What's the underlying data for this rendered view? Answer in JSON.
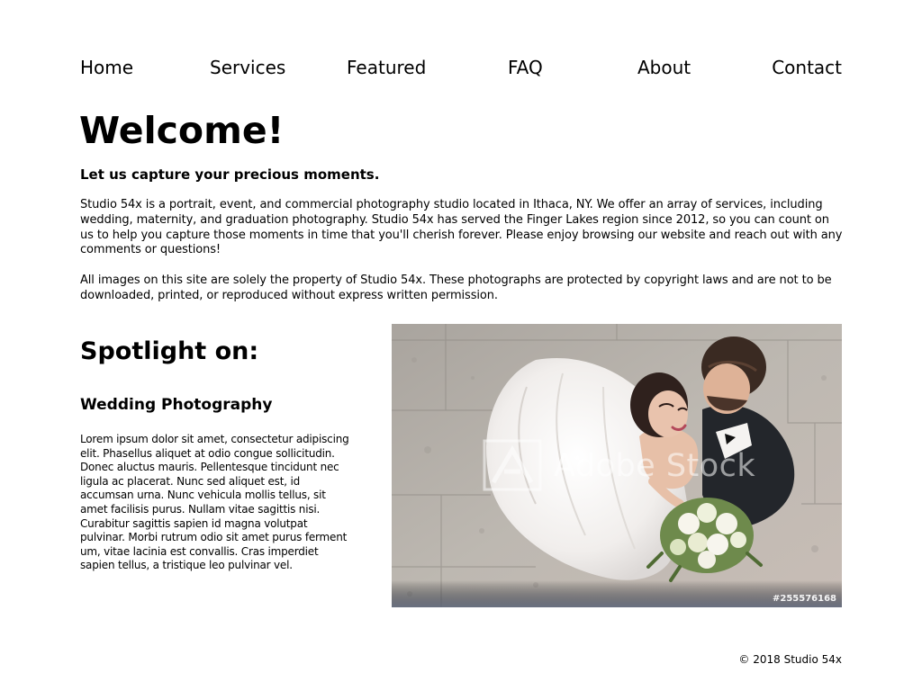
{
  "nav": {
    "items": [
      {
        "label": "Home"
      },
      {
        "label": "Services"
      },
      {
        "label": "Featured"
      },
      {
        "label": "FAQ"
      },
      {
        "label": "About"
      },
      {
        "label": "Contact"
      }
    ]
  },
  "welcome": {
    "title": "Welcome!",
    "tagline": "Let us capture your precious moments.",
    "paragraph_1": "Studio 54x is a portrait, event, and commercial photography studio located in Ithaca, NY.  We offer an array of services, including wedding, maternity, and graduation photography.  Studio 54x has served the Finger Lakes region since 2012, so you can count on us to help you capture those moments in time that you'll cherish forever. Please enjoy browsing our website and reach out with any comments or questions!",
    "paragraph_2": "All images on this site are solely the property of Studio 54x. These photographs are protected by copyright laws and are not to be downloaded, printed, or reproduced without express written permission."
  },
  "spotlight": {
    "title": "Spotlight on:",
    "subtitle": "Wedding Photography",
    "body": "Lorem ipsum dolor sit amet, consectetur adipiscing elit. Phasellus aliquet at odio congue sollicitudin. Donec aluctus mauris. Pellentesque tincidunt nec ligula ac placerat. Nunc sed aliquet est, id accumsan urna. Nunc vehicula mollis tellus, sit amet facilisis purus. Nullam vitae sagittis nisi. Curabitur sagittis sapien id magna volutpat pulvinar. Morbi rutrum odio sit amet purus ferment um, vitae lacinia est convallis. Cras imperdiet sapien tellus, a tristique leo pulvinar vel."
  },
  "photo": {
    "watermark": "Adobe Stock",
    "stock_id": "#255576168"
  },
  "footer": {
    "copyright": "© 2018 Studio 54x"
  },
  "colors": {
    "text": "#000000",
    "background": "#ffffff",
    "photo_stone": "#b9b4ad",
    "photo_dress": "#f1eeeb",
    "photo_suit": "#23262b"
  },
  "icons": {
    "watermark_logo": "adobe-stock-logo-icon"
  }
}
